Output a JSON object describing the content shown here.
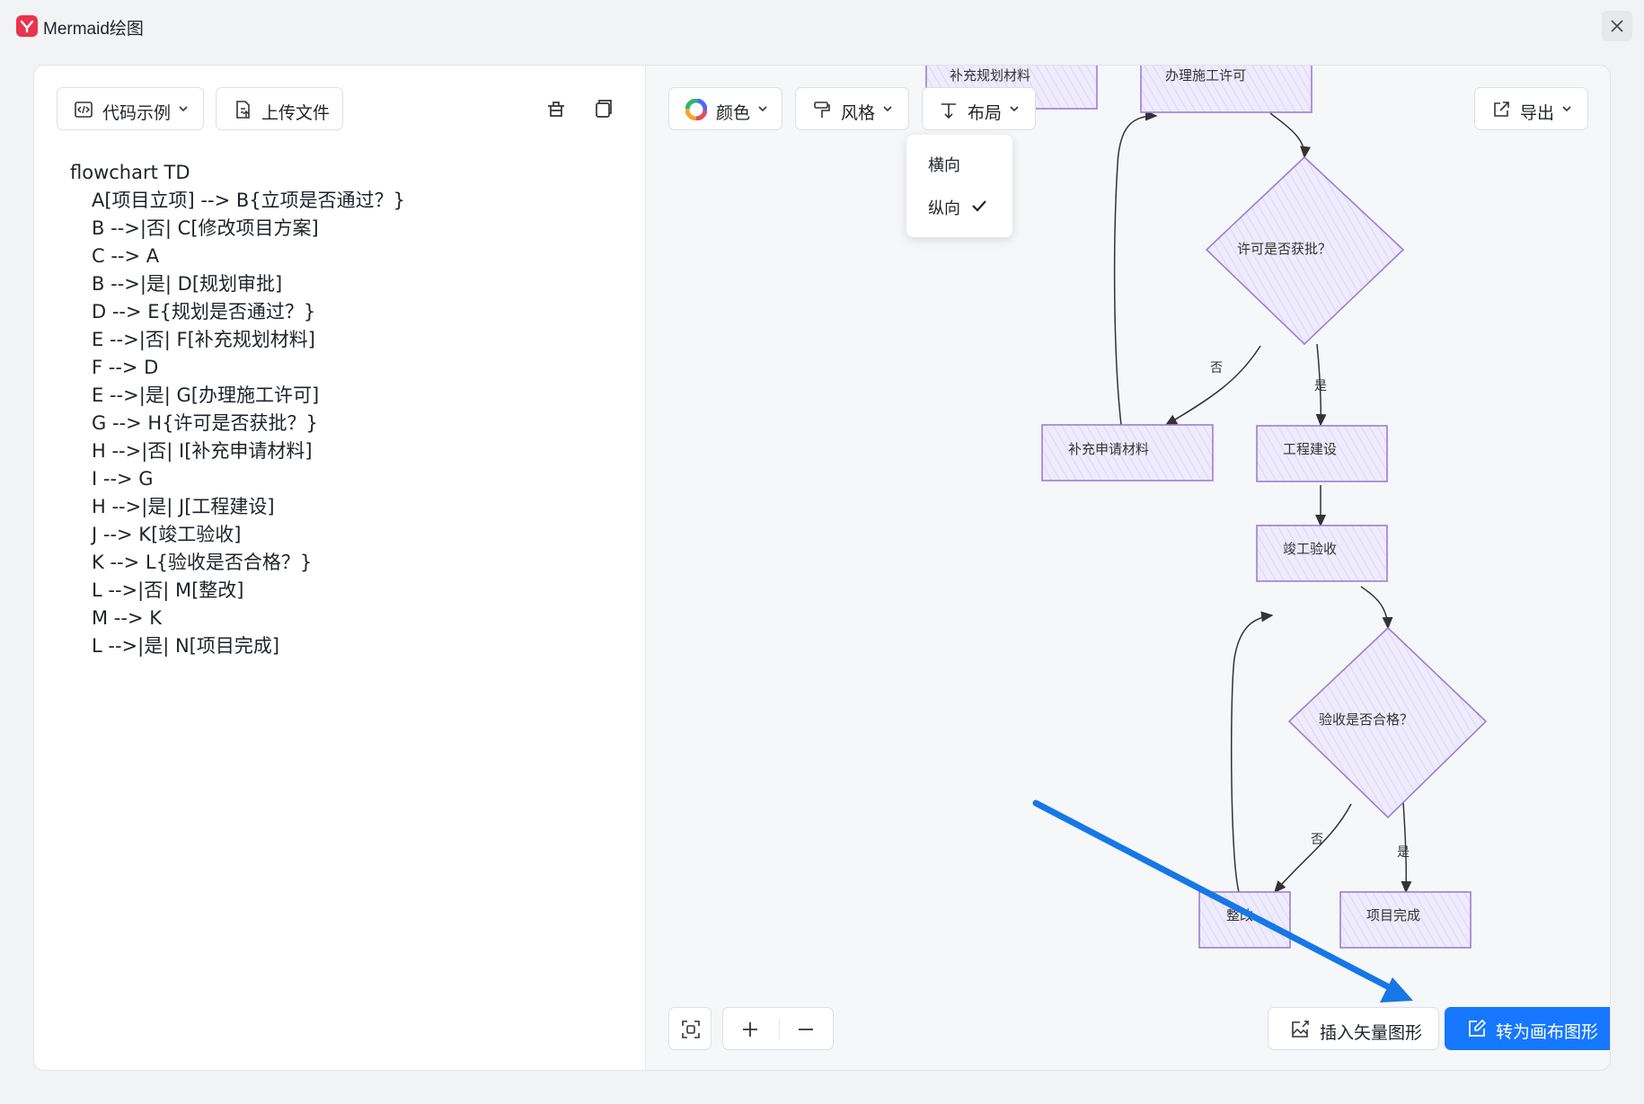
{
  "window": {
    "title": "Mermaid绘图"
  },
  "editor": {
    "code_examples_label": "代码示例",
    "upload_label": "上传文件",
    "code_lines": [
      "flowchart TD",
      "A[项目立项] --> B{立项是否通过？}",
      "B -->|否| C[修改项目方案]",
      "C --> A",
      "B -->|是| D[规划审批]",
      "D --> E{规划是否通过？}",
      "E -->|否| F[补充规划材料]",
      "F --> D",
      "E -->|是| G[办理施工许可]",
      "G --> H{许可是否获批？}",
      "H -->|否| I[补充申请材料]",
      "I --> G",
      "H -->|是| J[工程建设]",
      "J --> K[竣工验收]",
      "K --> L{验收是否合格？}",
      "L -->|否| M[整改]",
      "M --> K",
      "L -->|是| N[项目完成]"
    ]
  },
  "toolbar": {
    "color_label": "颜色",
    "style_label": "风格",
    "layout_label": "布局",
    "export_label": "导出"
  },
  "layout_menu": {
    "items": [
      {
        "label": "横向",
        "checked": false
      },
      {
        "label": "纵向",
        "checked": true
      }
    ]
  },
  "diagram": {
    "nodes": {
      "F": "补充规划材料",
      "G": "办理施工许可",
      "H": "许可是否获批？",
      "I": "补充申请材料",
      "J": "工程建设",
      "K": "竣工验收",
      "L": "验收是否合格？",
      "M": "整改",
      "N": "项目完成"
    },
    "edges": {
      "no": "否",
      "yes": "是"
    },
    "node_fill": "#ece9fb",
    "node_stroke": "#9b7fd6"
  },
  "footer": {
    "insert_vector_label": "插入矢量图形",
    "convert_canvas_label": "转为画布图形"
  },
  "colors": {
    "accent": "#1677ff",
    "annotation_arrow": "#1677e6"
  }
}
